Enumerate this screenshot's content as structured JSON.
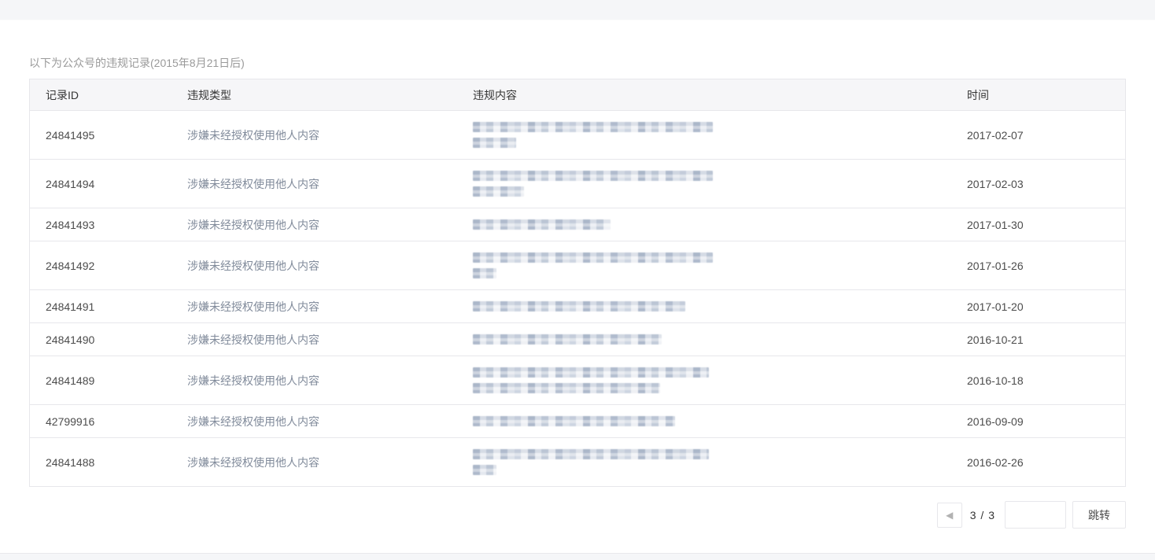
{
  "page": {
    "title": "以下为公众号的违规记录(2015年8月21日后)"
  },
  "table": {
    "columns": [
      "记录ID",
      "违规类型",
      "违规内容",
      "时间"
    ],
    "rows": [
      {
        "id": "24841495",
        "type": "涉嫌未经授权使用他人内容",
        "content_redacted": true,
        "redacted_line_widths": [
          305,
          55
        ],
        "date": "2017-02-07"
      },
      {
        "id": "24841494",
        "type": "涉嫌未经授权使用他人内容",
        "content_redacted": true,
        "redacted_line_widths": [
          305,
          65
        ],
        "date": "2017-02-03"
      },
      {
        "id": "24841493",
        "type": "涉嫌未经授权使用他人内容",
        "content_redacted": true,
        "redacted_line_widths": [
          175
        ],
        "date": "2017-01-30"
      },
      {
        "id": "24841492",
        "type": "涉嫌未经授权使用他人内容",
        "content_redacted": true,
        "redacted_line_widths": [
          305,
          30
        ],
        "date": "2017-01-26"
      },
      {
        "id": "24841491",
        "type": "涉嫌未经授权使用他人内容",
        "content_redacted": true,
        "redacted_line_widths": [
          270
        ],
        "date": "2017-01-20"
      },
      {
        "id": "24841490",
        "type": "涉嫌未经授权使用他人内容",
        "content_redacted": true,
        "redacted_line_widths": [
          240
        ],
        "date": "2016-10-21"
      },
      {
        "id": "24841489",
        "type": "涉嫌未经授权使用他人内容",
        "content_redacted": true,
        "redacted_line_widths": [
          300,
          238
        ],
        "date": "2016-10-18"
      },
      {
        "id": "42799916",
        "type": "涉嫌未经授权使用他人内容",
        "content_redacted": true,
        "redacted_line_widths": [
          257
        ],
        "date": "2016-09-09"
      },
      {
        "id": "24841488",
        "type": "涉嫌未经授权使用他人内容",
        "content_redacted": true,
        "redacted_line_widths": [
          300,
          30
        ],
        "date": "2016-02-26"
      }
    ]
  },
  "pagination": {
    "prev_icon": "◀",
    "page_indicator": "3 / 3",
    "jump_input_value": "",
    "jump_button_label": "跳转"
  },
  "colors": {
    "bar_background": "#f5f6f8",
    "table_border": "#e7e7eb",
    "header_background": "#f6f6f8",
    "title_text": "#9a9a9a",
    "primary_text": "#4c4c4c",
    "violation_type_text": "#818b9b"
  }
}
